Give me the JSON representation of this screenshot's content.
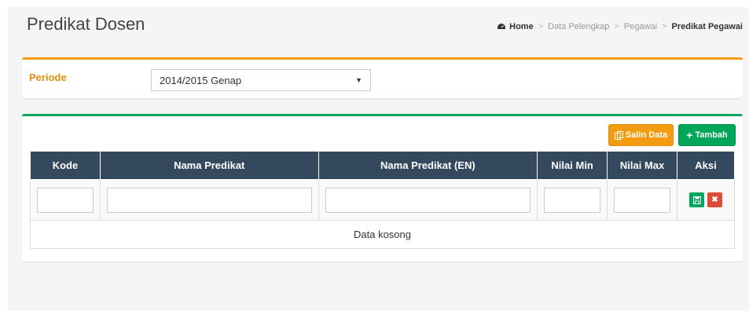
{
  "header": {
    "title": "Predikat Dosen",
    "breadcrumb": [
      "Home",
      "Data Pelengkap",
      "Pegawai",
      "Predikat Pegawai"
    ]
  },
  "filter": {
    "label": "Periode",
    "selected": "2014/2015 Genap"
  },
  "toolbar": {
    "salin_label": "Salin Data",
    "tambah_label": "Tambah"
  },
  "table": {
    "columns": [
      "Kode",
      "Nama Predikat",
      "Nama Predikat (EN)",
      "Nilai Min",
      "Nilai Max",
      "Aksi"
    ],
    "empty_text": "Data kosong"
  },
  "colors": {
    "filter_accent": "#f39c12",
    "table_accent": "#00a65a",
    "header_bg": "#34495e",
    "save": "#00a65a",
    "delete": "#dd4b39"
  },
  "icons": [
    "dashboard-icon",
    "copy-icon",
    "plus-icon",
    "save-icon",
    "close-icon",
    "caret-down-icon"
  ]
}
